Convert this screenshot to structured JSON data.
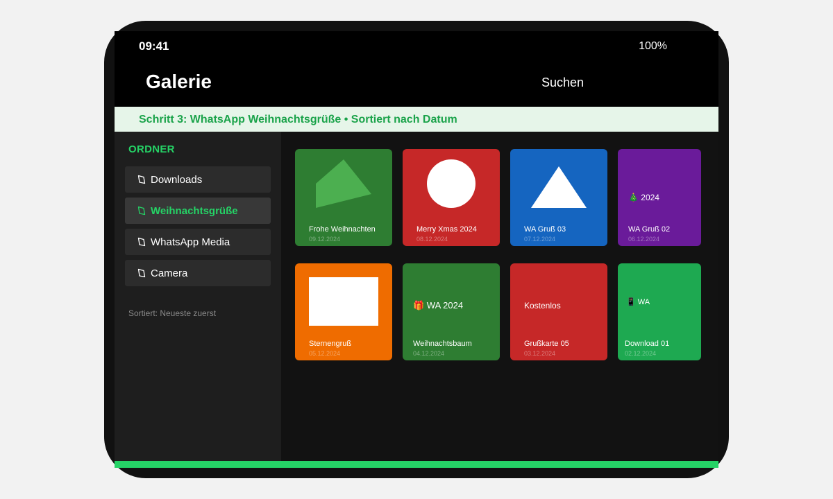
{
  "status": {
    "time": "09:41",
    "battery": "100%"
  },
  "appbar": {
    "title": "Galerie",
    "search_label": "Suchen"
  },
  "banner": {
    "text": "Schritt 3: WhatsApp Weihnachtsgrüße • Sortiert nach Datum"
  },
  "sidebar": {
    "heading": "ORDNER",
    "folders": [
      {
        "label": "Downloads",
        "active": false
      },
      {
        "label": "Weihnachtsgrüße",
        "active": true
      },
      {
        "label": "WhatsApp Media",
        "active": false
      },
      {
        "label": "Camera",
        "active": false
      }
    ],
    "sort_note": "Sortiert: Neueste zuerst"
  },
  "gallery": {
    "items": [
      {
        "name": "Frohe Weihnachten",
        "date": "09.12.2024",
        "color": "#2e7d32",
        "thumb": "pentagon-shape"
      },
      {
        "name": "Merry Xmas 2024",
        "date": "08.12.2024",
        "color": "#c62828",
        "thumb": "circle-shape"
      },
      {
        "name": "WA Gruß 03",
        "date": "07.12.2024",
        "color": "#1565c0",
        "thumb": "triangle-shape"
      },
      {
        "name": "WA Gruß 02",
        "date": "06.12.2024",
        "color": "#6a1b9a",
        "thumb": "christmas-tree-icon",
        "thumb_text": "🎄 2024"
      },
      {
        "name": "Sternengruß",
        "date": "05.12.2024",
        "color": "#ef6c00",
        "thumb": "rectangle-shape"
      },
      {
        "name": "Weihnachtsbaum",
        "date": "04.12.2024",
        "color": "#2e7d32",
        "thumb": "gift-icon",
        "thumb_text": "🎁 WA 2024"
      },
      {
        "name": "Grußkarte 05",
        "date": "03.12.2024",
        "color": "#c62828",
        "thumb": "text",
        "thumb_text": "Kostenlos"
      },
      {
        "name": "Download 01",
        "date": "02.12.2024",
        "color": "#1ea951",
        "thumb": "phone-icon",
        "thumb_text": "📱 WA"
      }
    ]
  },
  "colors": {
    "accent": "#25d366",
    "banner_bg": "#e6f5e9",
    "banner_text": "#1aa34a"
  }
}
